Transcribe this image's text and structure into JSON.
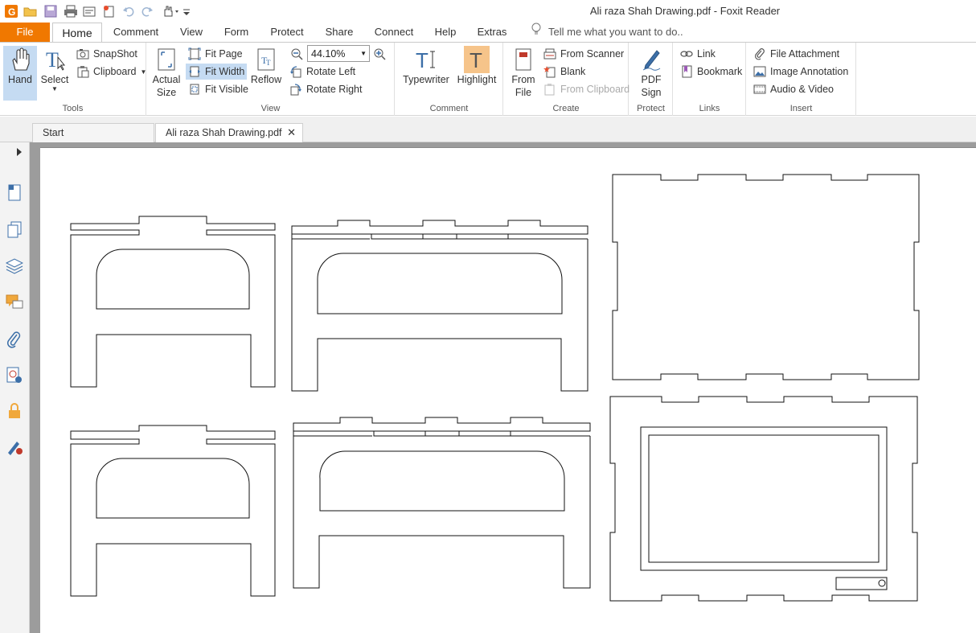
{
  "window": {
    "title": "Ali raza Shah Drawing.pdf - Foxit Reader"
  },
  "menu": {
    "tabs": [
      "File",
      "Home",
      "Comment",
      "View",
      "Form",
      "Protect",
      "Share",
      "Connect",
      "Help",
      "Extras"
    ],
    "tell_me": "Tell me what you want to do.."
  },
  "ribbon": {
    "tools": {
      "hand": "Hand",
      "select": "Select",
      "snapshot": "SnapShot",
      "clipboard": "Clipboard",
      "group": "Tools"
    },
    "view": {
      "actual_size_1": "Actual",
      "actual_size_2": "Size",
      "fit_page": "Fit Page",
      "fit_width": "Fit Width",
      "fit_visible": "Fit Visible",
      "reflow": "Reflow",
      "zoom_value": "44.10%",
      "rotate_left": "Rotate Left",
      "rotate_right": "Rotate Right",
      "group": "View"
    },
    "comment": {
      "typewriter": "Typewriter",
      "highlight": "Highlight",
      "group": "Comment"
    },
    "create": {
      "from_file_1": "From",
      "from_file_2": "File",
      "from_scanner": "From Scanner",
      "blank": "Blank",
      "from_clipboard": "From Clipboard",
      "group": "Create"
    },
    "protect": {
      "pdf_sign_1": "PDF",
      "pdf_sign_2": "Sign",
      "group": "Protect"
    },
    "links": {
      "link": "Link",
      "bookmark": "Bookmark",
      "group": "Links"
    },
    "insert": {
      "file_attachment": "File Attachment",
      "image_annotation": "Image Annotation",
      "audio_video": "Audio & Video",
      "group": "Insert"
    }
  },
  "doc_tabs": {
    "start": "Start",
    "document": "Ali raza Shah Drawing.pdf",
    "close_glyph": "✕"
  },
  "colors": {
    "accent": "#f07800",
    "hover": "#c5dbf2",
    "highlight_btn": "#f6c48a"
  }
}
